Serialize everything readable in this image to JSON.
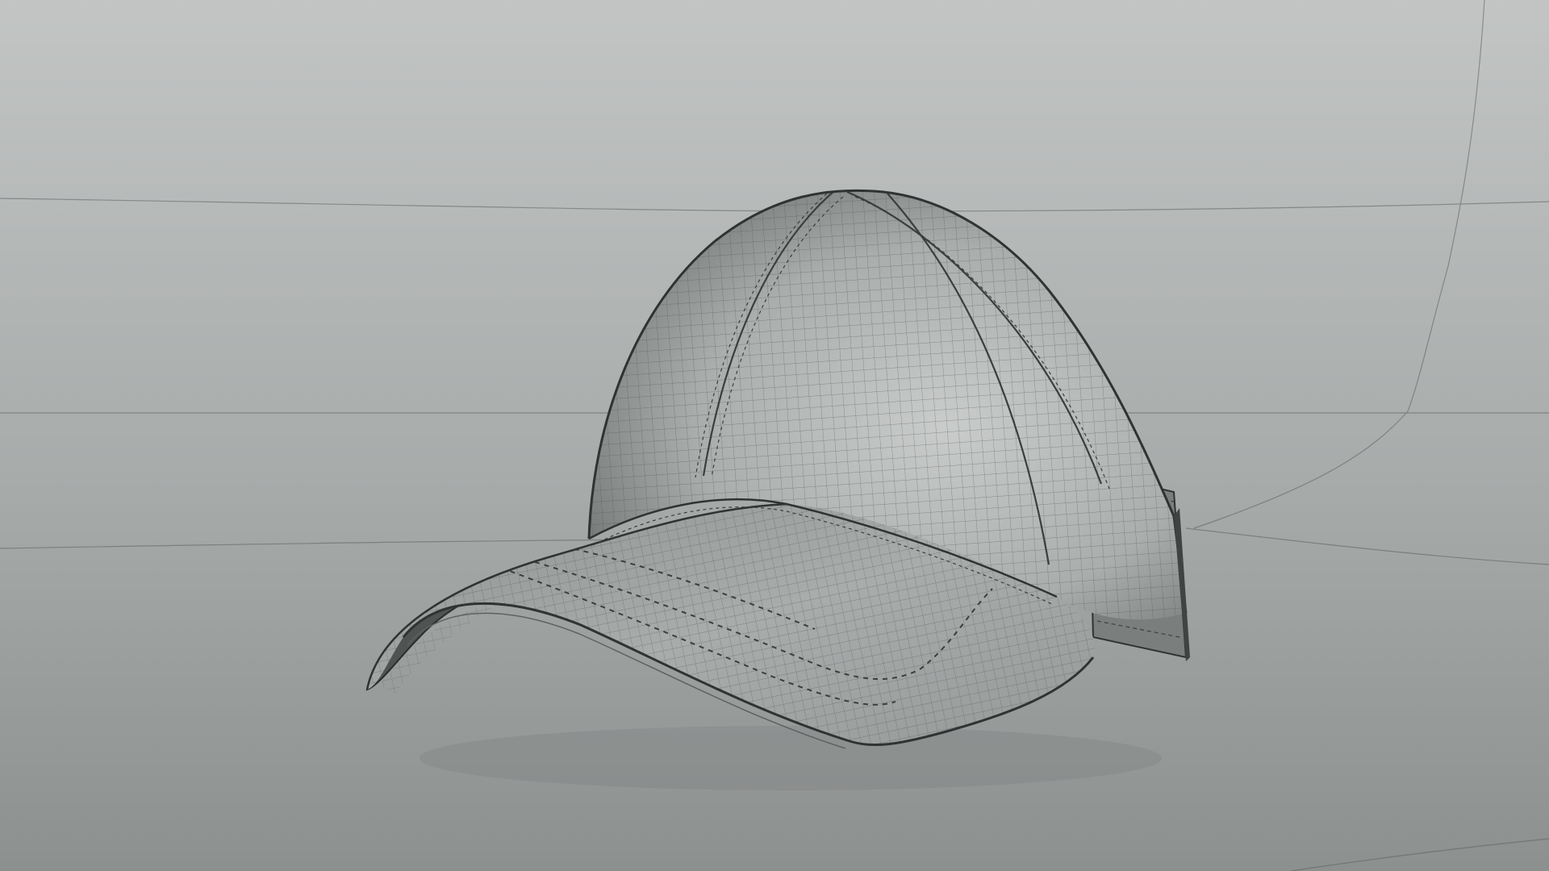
{
  "scene": {
    "kind": "3d-modeling-viewport",
    "subject": "baseball-cap-wireframe-model",
    "colors": {
      "background_top": "#bfc2c1",
      "background_bottom": "#8f9391",
      "mesh_fill_light": "#c3c6c5",
      "mesh_fill_dark": "#6e7371",
      "wire": "#4a4e4d",
      "edge": "#2f3332"
    }
  }
}
